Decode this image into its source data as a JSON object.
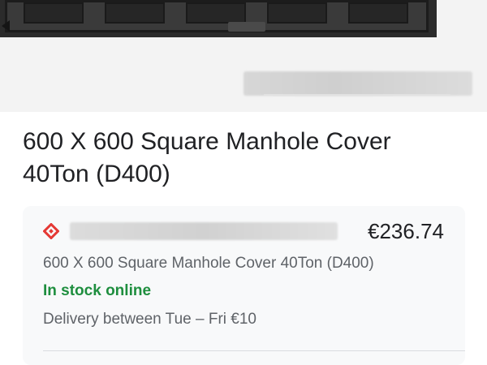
{
  "product": {
    "title_line1": "600 X 600 Square Manhole Cover",
    "title_line2": "40Ton (D400)"
  },
  "offer": {
    "price": "€236.74",
    "description": "600 X 600 Square Manhole Cover 40Ton (D400)",
    "stock_status": "In stock online",
    "delivery": "Delivery between Tue – Fri €10",
    "logo_icon": "seller-diamond-logo-icon",
    "accent_color": "#e53935",
    "stock_color": "#1e8e3e"
  }
}
